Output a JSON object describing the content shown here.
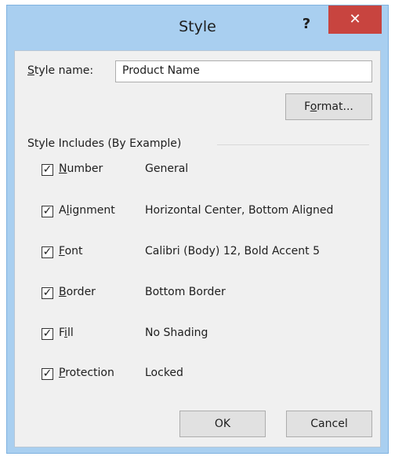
{
  "window": {
    "title": "Style",
    "help_symbol": "?",
    "close_symbol": "✕"
  },
  "style_name": {
    "label_prefix": "",
    "label_u": "S",
    "label_rest": "tyle name:",
    "value": "Product Name"
  },
  "format_button": {
    "pre": "F",
    "u": "o",
    "post": "rmat..."
  },
  "group_label": "Style Includes (By Example)",
  "options": [
    {
      "pre": "",
      "u": "N",
      "post": "umber",
      "value": "General",
      "checked": true
    },
    {
      "pre": "A",
      "u": "l",
      "post": "ignment",
      "value": "Horizontal Center, Bottom Aligned",
      "checked": true
    },
    {
      "pre": "",
      "u": "F",
      "post": "ont",
      "value": "Calibri (Body) 12, Bold Accent 5",
      "checked": true
    },
    {
      "pre": "",
      "u": "B",
      "post": "order",
      "value": "Bottom Border",
      "checked": true
    },
    {
      "pre": "F",
      "u": "i",
      "post": "ll",
      "value": "No Shading",
      "checked": true
    },
    {
      "pre": "",
      "u": "P",
      "post": "rotection",
      "value": "Locked",
      "checked": true
    }
  ],
  "ok_label": "OK",
  "cancel_label": "Cancel",
  "checkmark": "✓"
}
